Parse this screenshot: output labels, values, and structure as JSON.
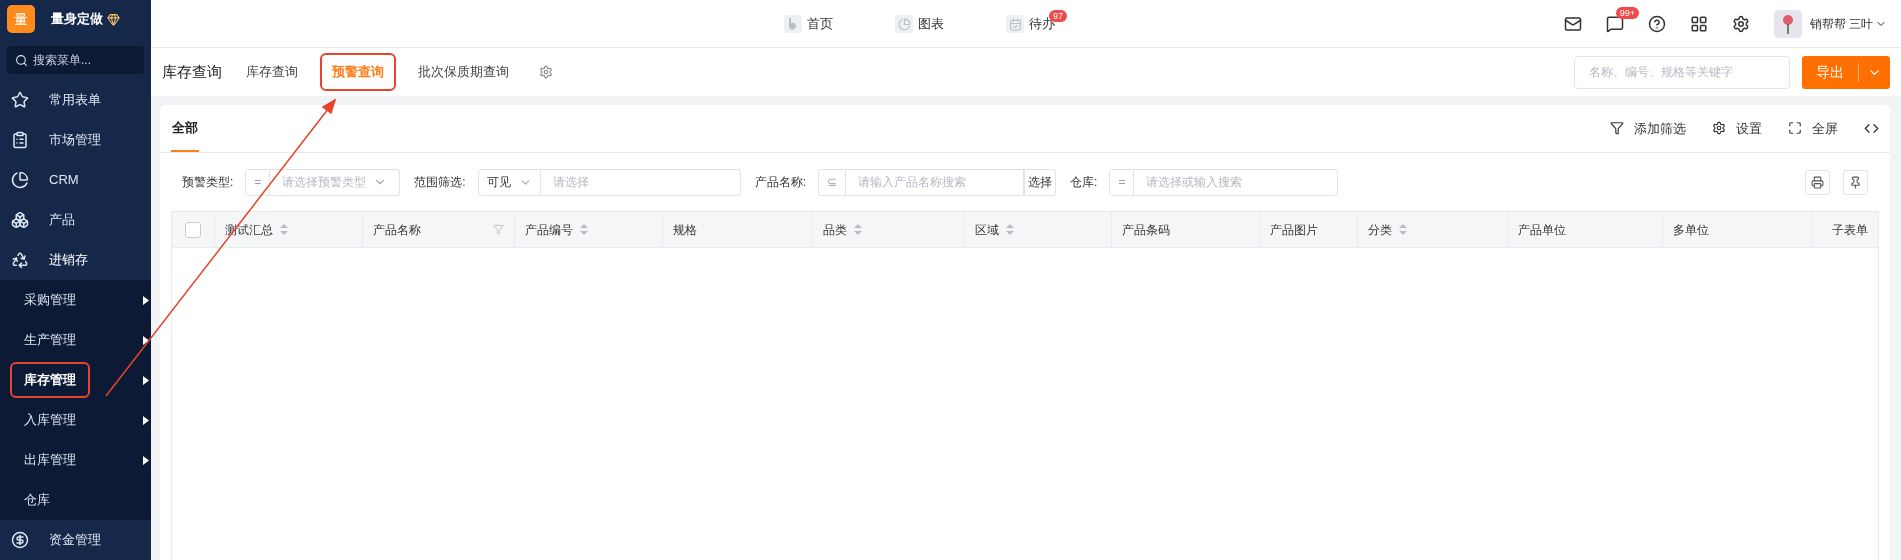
{
  "brand": {
    "logo": "量",
    "name": "量身定做"
  },
  "sidebar": {
    "search": {
      "placeholder": "搜索菜单..."
    },
    "items": [
      {
        "label": "常用表单",
        "expanded": false
      },
      {
        "label": "市场管理",
        "expanded": false
      },
      {
        "label": "CRM",
        "expanded": false
      },
      {
        "label": "产品",
        "expanded": false
      },
      {
        "label": "进销存",
        "expanded": true,
        "children": [
          {
            "label": "采购管理",
            "has_submenu": true,
            "selected": false
          },
          {
            "label": "生产管理",
            "has_submenu": true,
            "selected": false
          },
          {
            "label": "库存管理",
            "has_submenu": true,
            "selected": true
          },
          {
            "label": "入库管理",
            "has_submenu": true,
            "selected": false
          },
          {
            "label": "出库管理",
            "has_submenu": true,
            "selected": false
          },
          {
            "label": "仓库",
            "has_submenu": false,
            "selected": false
          }
        ]
      },
      {
        "label": "资金管理",
        "expanded": false
      }
    ]
  },
  "top_nav": [
    {
      "label": "首页"
    },
    {
      "label": "图表"
    },
    {
      "label": "待办",
      "badge": "97"
    }
  ],
  "top_right": {
    "message_badge": "99+",
    "user": "销帮帮 三叶"
  },
  "page": {
    "title": "库存查询",
    "tabs": [
      {
        "label": "库存查询",
        "selected": false
      },
      {
        "label": "预警查询",
        "selected": true
      },
      {
        "label": "批次保质期查询",
        "selected": false
      }
    ],
    "search": {
      "placeholder": "名称、编号、规格等关键字"
    },
    "export": "导出"
  },
  "card": {
    "tabs": [
      {
        "label": "全部",
        "selected": true
      }
    ],
    "actions": [
      "添加筛选",
      "设置",
      "全屏"
    ]
  },
  "filters": [
    {
      "label": "预警类型:",
      "operator": "=",
      "kind": "select",
      "placeholder": "请选择预警类型"
    },
    {
      "label": "范围筛选:",
      "operator": "可见",
      "kind": "scope",
      "placeholder": "请选择"
    },
    {
      "label": "产品名称:",
      "operator": "⊆",
      "kind": "picker",
      "placeholder": "请输入产品名称搜索",
      "button": "选择"
    },
    {
      "label": "仓库:",
      "operator": "=",
      "kind": "text",
      "placeholder": "请选择或输入搜索"
    }
  ],
  "table": {
    "columns": [
      {
        "label": "测试汇总",
        "sortable": true,
        "filterable": false
      },
      {
        "label": "产品名称",
        "sortable": false,
        "filterable": true
      },
      {
        "label": "产品编号",
        "sortable": true,
        "filterable": false
      },
      {
        "label": "规格",
        "sortable": false,
        "filterable": false
      },
      {
        "label": "品类",
        "sortable": true,
        "filterable": false
      },
      {
        "label": "区域",
        "sortable": true,
        "filterable": false
      },
      {
        "label": "产品条码",
        "sortable": false,
        "filterable": false
      },
      {
        "label": "产品图片",
        "sortable": false,
        "filterable": false
      },
      {
        "label": "分类",
        "sortable": true,
        "filterable": false
      },
      {
        "label": "产品单位",
        "sortable": false,
        "filterable": false
      },
      {
        "label": "多单位",
        "sortable": false,
        "filterable": false
      },
      {
        "label": "子表单",
        "sortable": false,
        "filterable": false
      }
    ],
    "all_checked": false
  }
}
